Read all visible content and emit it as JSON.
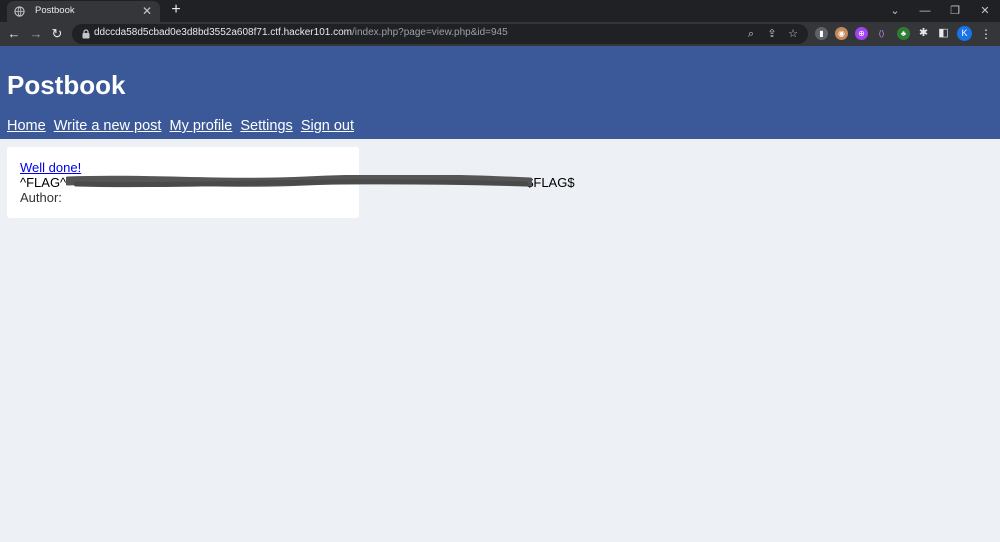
{
  "browser": {
    "tab_title": "Postbook",
    "url_host": "ddccda58d5cbad0e3d8bd3552a608f71.ctf.hacker101.com",
    "url_path": "/index.php?page=view.php&id=945",
    "profile_initial": "K",
    "accent_color": "#1a73e8"
  },
  "site": {
    "title": "Postbook",
    "header_color": "#3b5998",
    "nav": [
      {
        "label": "Home"
      },
      {
        "label": "Write a new post"
      },
      {
        "label": "My profile"
      },
      {
        "label": "Settings"
      },
      {
        "label": "Sign out"
      }
    ]
  },
  "post": {
    "title": "Well done!",
    "body_prefix": "^FLAG^",
    "body_suffix": "$FLAG$",
    "author_label": "Author:"
  }
}
